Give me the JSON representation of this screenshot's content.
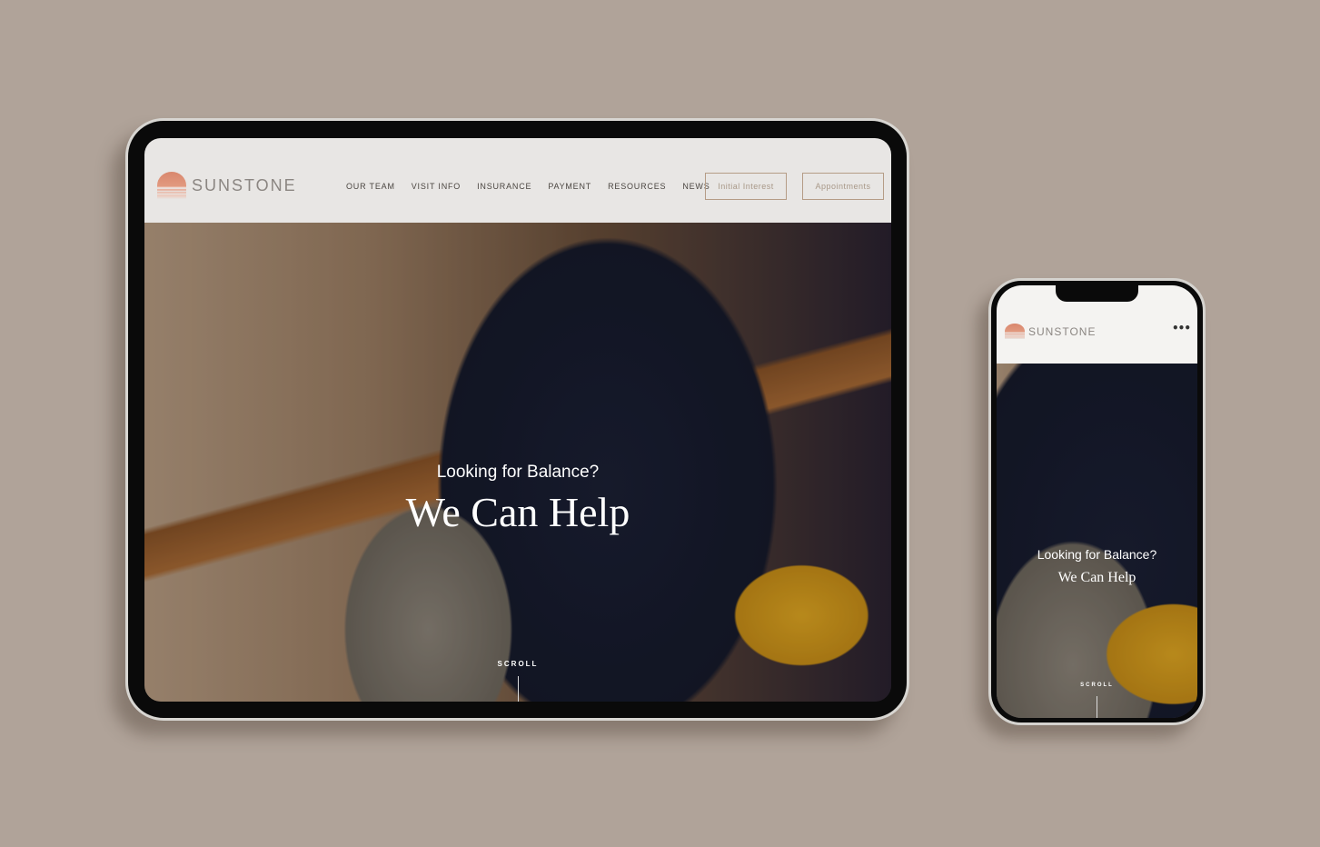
{
  "brand": {
    "name": "SUNSTONE",
    "logo_color": "#d9876d"
  },
  "tablet": {
    "nav": [
      {
        "label": "OUR TEAM"
      },
      {
        "label": "VISIT INFO"
      },
      {
        "label": "INSURANCE"
      },
      {
        "label": "PAYMENT"
      },
      {
        "label": "RESOURCES"
      },
      {
        "label": "NEWS"
      }
    ],
    "buttons": {
      "initial_interest": "Initial Interest",
      "appointments": "Appointments"
    },
    "hero": {
      "kicker": "Looking for Balance?",
      "headline": "We Can Help",
      "scroll": "SCROLL"
    }
  },
  "phone": {
    "menu_icon": "ellipsis-icon",
    "hero": {
      "kicker": "Looking for Balance?",
      "headline": "We Can Help",
      "scroll": "SCROLL"
    }
  },
  "colors": {
    "background": "#b0a399",
    "header": "#e8e6e4",
    "button_border": "#b59c86"
  }
}
